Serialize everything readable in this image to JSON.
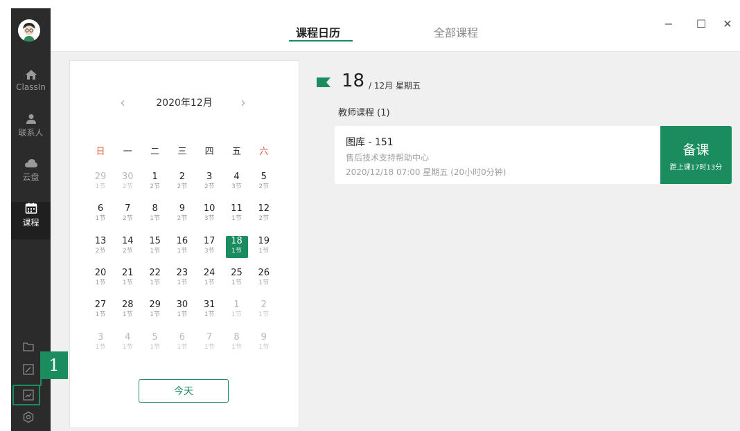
{
  "sidebar": {
    "nav": [
      {
        "label": "ClassIn",
        "icon": "home-icon"
      },
      {
        "label": "联系人",
        "icon": "person-icon"
      },
      {
        "label": "云盘",
        "icon": "cloud-icon"
      },
      {
        "label": "课程",
        "icon": "calendar-icon"
      }
    ],
    "tools": [
      "folder-icon",
      "edit-icon",
      "chart-icon",
      "settings-icon"
    ],
    "callout_number": "1"
  },
  "tabs": [
    {
      "label": "课程日历",
      "active": true
    },
    {
      "label": "全部课程",
      "active": false
    }
  ],
  "window_controls": {
    "minimize": "−",
    "maximize": "☐",
    "close": "✕"
  },
  "calendar": {
    "prev": "‹",
    "next": "›",
    "month_title": "2020年12月",
    "weekdays": [
      "日",
      "一",
      "二",
      "三",
      "四",
      "五",
      "六"
    ],
    "weeks": [
      [
        {
          "d": "29",
          "s": "1节",
          "o": true
        },
        {
          "d": "30",
          "s": "2节",
          "o": true
        },
        {
          "d": "1",
          "s": "2节"
        },
        {
          "d": "2",
          "s": "2节"
        },
        {
          "d": "3",
          "s": "2节"
        },
        {
          "d": "4",
          "s": "3节"
        },
        {
          "d": "5",
          "s": "2节"
        }
      ],
      [
        {
          "d": "6",
          "s": "1节"
        },
        {
          "d": "7",
          "s": "2节"
        },
        {
          "d": "8",
          "s": "1节"
        },
        {
          "d": "9",
          "s": "2节"
        },
        {
          "d": "10",
          "s": "3节"
        },
        {
          "d": "11",
          "s": "1节"
        },
        {
          "d": "12",
          "s": "2节"
        }
      ],
      [
        {
          "d": "13",
          "s": "2节"
        },
        {
          "d": "14",
          "s": "2节"
        },
        {
          "d": "15",
          "s": "1节"
        },
        {
          "d": "16",
          "s": "1节"
        },
        {
          "d": "17",
          "s": "3节"
        },
        {
          "d": "18",
          "s": "1节",
          "sel": true
        },
        {
          "d": "19",
          "s": "1节"
        }
      ],
      [
        {
          "d": "20",
          "s": "1节"
        },
        {
          "d": "21",
          "s": "1节"
        },
        {
          "d": "22",
          "s": "1节"
        },
        {
          "d": "23",
          "s": "1节"
        },
        {
          "d": "24",
          "s": "1节"
        },
        {
          "d": "25",
          "s": "1节"
        },
        {
          "d": "26",
          "s": "1节"
        }
      ],
      [
        {
          "d": "27",
          "s": "1节"
        },
        {
          "d": "28",
          "s": "1节"
        },
        {
          "d": "29",
          "s": "1节"
        },
        {
          "d": "30",
          "s": "1节"
        },
        {
          "d": "31",
          "s": "1节"
        },
        {
          "d": "1",
          "s": "1节",
          "o": true
        },
        {
          "d": "2",
          "s": "1节",
          "o": true
        }
      ],
      [
        {
          "d": "3",
          "s": "1节",
          "o": true
        },
        {
          "d": "4",
          "s": "1节",
          "o": true
        },
        {
          "d": "5",
          "s": "1节",
          "o": true
        },
        {
          "d": "6",
          "s": "1节",
          "o": true
        },
        {
          "d": "7",
          "s": "1节",
          "o": true
        },
        {
          "d": "8",
          "s": "1节",
          "o": true
        },
        {
          "d": "9",
          "s": "1节",
          "o": true
        }
      ]
    ],
    "today_button": "今天"
  },
  "day_view": {
    "day": "18",
    "sub": "/ 12月 星期五",
    "section_title": "教师课程 (1)",
    "course": {
      "title": "图库 - 151",
      "desc": "售后技术支持帮助中心",
      "time": "2020/12/18 07:00 星期五 (20小时0分钟)",
      "action_label": "备课",
      "action_sub": "距上课17时13分"
    }
  },
  "colors": {
    "accent": "#1a8c5e",
    "sidebar": "#2b2b2b",
    "weekend_red": "#e05a3a"
  }
}
